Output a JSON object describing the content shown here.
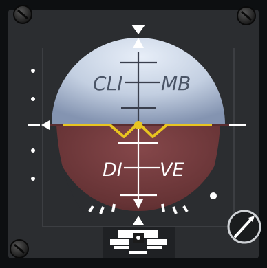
{
  "instrument": {
    "climb_label_left": "CLI",
    "climb_label_right": "MB",
    "dive_label_left": "DI",
    "dive_label_right": "VE",
    "colors": {
      "bezel": "#101214",
      "panel": "#2a2c2e",
      "sky_light": "#d7e0ec",
      "sky_dark": "#9fb0c9",
      "ground_light": "#7b4142",
      "ground_dark": "#4a2426",
      "aircraft_symbol": "#e8c420",
      "markings": "#ffffff"
    },
    "icons": {
      "screws": "screw-icon",
      "knob": "adjust-knob-icon"
    }
  }
}
